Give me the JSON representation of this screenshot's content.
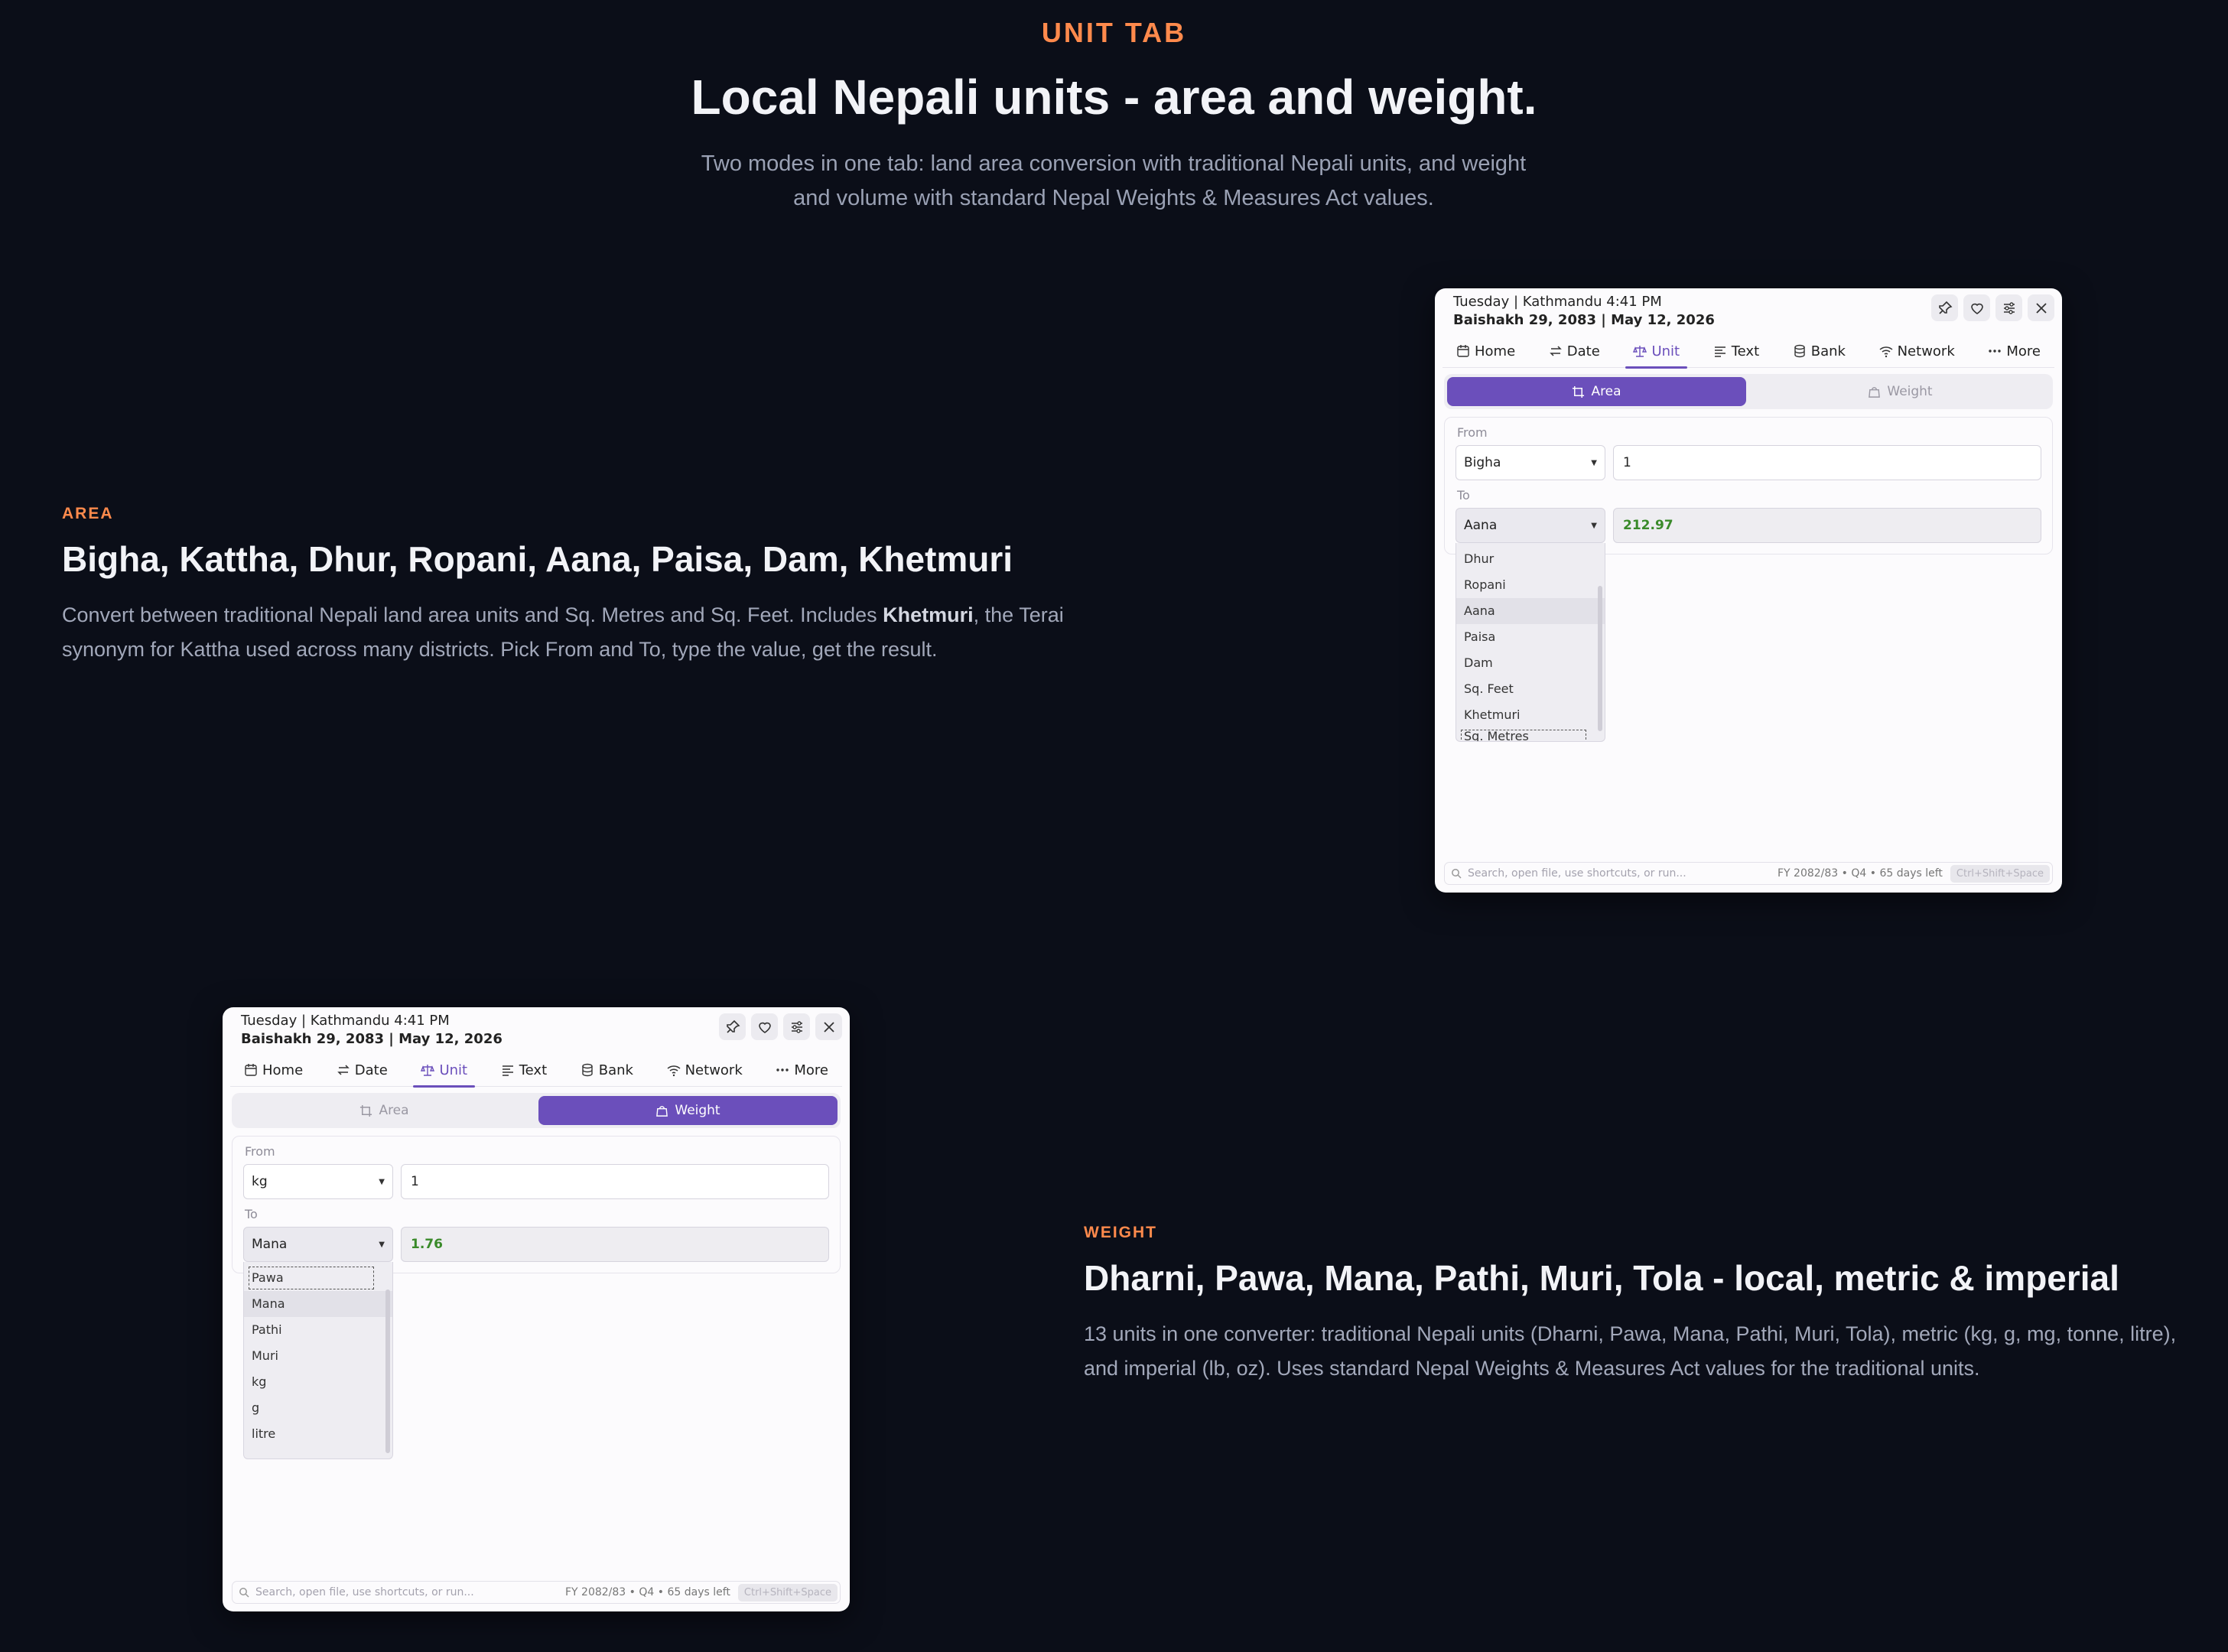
{
  "hero": {
    "eyebrow": "UNIT TAB",
    "title": "Local Nepali units - area and weight.",
    "lede": "Two modes in one tab: land area conversion with traditional Nepali units, and weight and volume with standard Nepal Weights & Measures Act values."
  },
  "area": {
    "tag": "AREA",
    "title": "Bigha, Kattha, Dhur, Ropani, Aana, Paisa, Dam, Khetmuri",
    "desc_pre": "Convert between traditional Nepali land area units and Sq. Metres and Sq. Feet. Includes ",
    "desc_bold": "Khetmuri",
    "desc_post": ", the Terai synonym for Kattha used across many districts. Pick From and To, type the value, get the result."
  },
  "weight": {
    "tag": "WEIGHT",
    "title": "Dharni, Pawa, Mana, Pathi, Muri, Tola - local, metric & imperial",
    "desc": "13 units in one converter: traditional Nepali units (Dharni, Pawa, Mana, Pathi, Muri, Tola), metric (kg, g, mg, tonne, litre), and imperial (lb, oz). Uses standard Nepal Weights & Measures Act values for the traditional units."
  },
  "app": {
    "line1": "Tuesday | Kathmandu 4:41 PM",
    "line2": "Baishakh 29, 2083 | May 12, 2026",
    "tabs": [
      "Home",
      "Date",
      "Unit",
      "Text",
      "Bank",
      "Network",
      "More"
    ],
    "modes": [
      "Area",
      "Weight"
    ],
    "from_label": "From",
    "to_label": "To",
    "search_placeholder": "Search, open file, use shortcuts, or run...",
    "fy_info": "FY 2082/83 • Q4 • 65 days left",
    "shortcut": "Ctrl+Shift+Space"
  },
  "area_window": {
    "from_unit": "Bigha",
    "from_value": "1",
    "to_unit": "Aana",
    "result": "212.97",
    "options": [
      "Dhur",
      "Ropani",
      "Aana",
      "Paisa",
      "Dam",
      "Sq. Feet",
      "Khetmuri",
      "Sq. Metres"
    ]
  },
  "weight_window": {
    "from_unit": "kg",
    "from_value": "1",
    "to_unit": "Mana",
    "result": "1.76",
    "options": [
      "Pawa",
      "Mana",
      "Pathi",
      "Muri",
      "kg",
      "g",
      "litre"
    ]
  },
  "colors": {
    "accent": "#6b4fbb",
    "orange": "#ff8a4c",
    "background": "#0b0e18",
    "result_green": "#3a8a2a"
  }
}
